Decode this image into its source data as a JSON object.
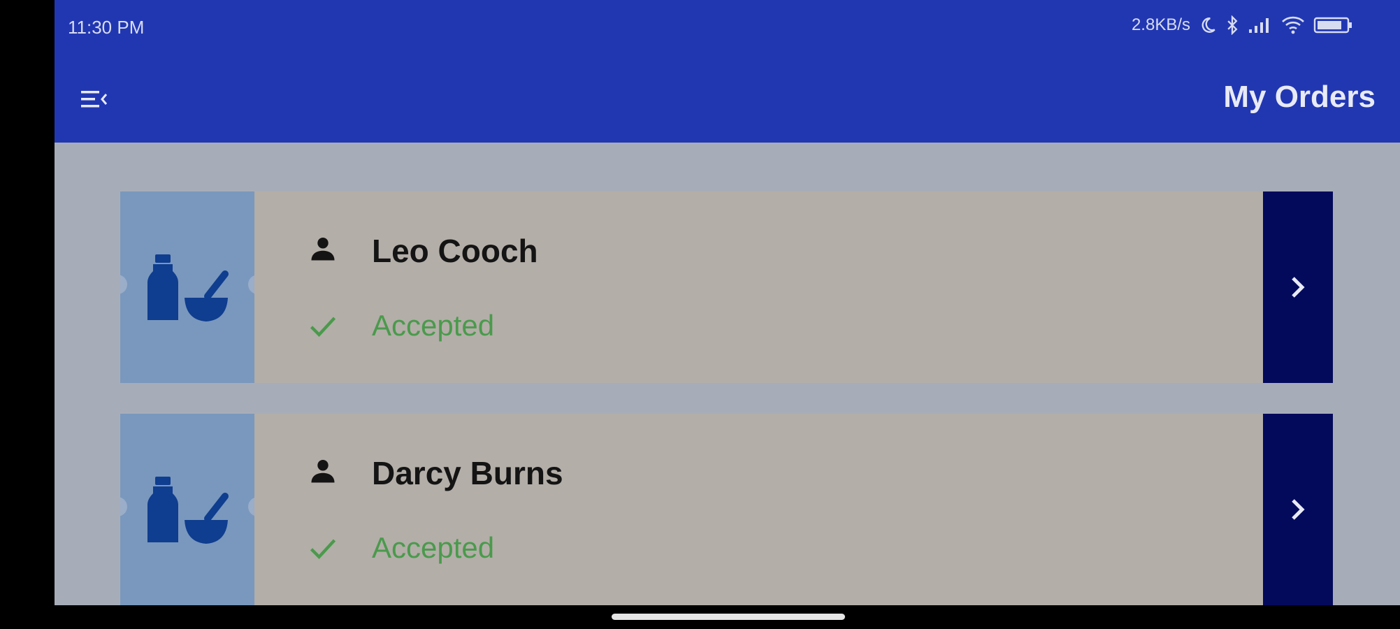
{
  "status_bar": {
    "time": "11:30 PM",
    "net_speed": "2.8KB/s"
  },
  "header": {
    "title": "My Orders",
    "menu_icon": "menu-icon"
  },
  "orders": [
    {
      "name": "Leo Cooch",
      "status": "Accepted",
      "icon": "pharmacy-icon"
    },
    {
      "name": "Darcy Burns",
      "status": "Accepted",
      "icon": "pharmacy-icon"
    }
  ],
  "colors": {
    "appbar": "#2137b2",
    "accent_arrow": "#030a5c",
    "status_accepted": "#4a9a4c"
  }
}
